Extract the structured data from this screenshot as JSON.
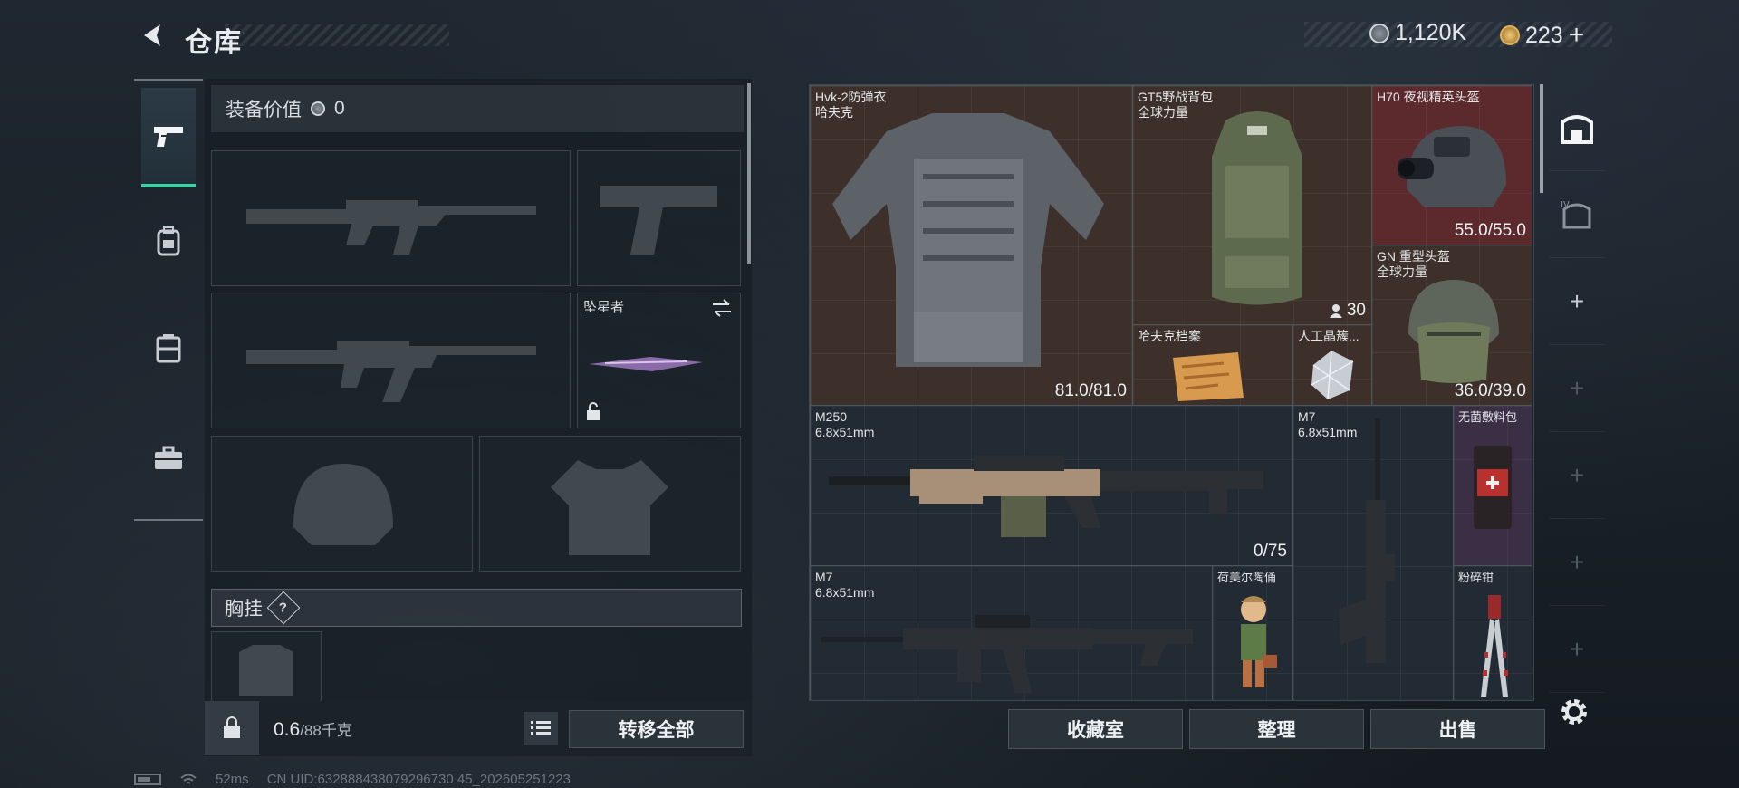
{
  "header": {
    "title": "仓库",
    "currencies": [
      {
        "icon": "silver-coin-icon",
        "value": "1,120K"
      },
      {
        "icon": "gold-coin-icon",
        "value": "223"
      }
    ],
    "add_symbol": "+"
  },
  "left_nav": {
    "tabs": [
      {
        "icon": "pistol-icon",
        "active": true
      },
      {
        "icon": "backpack-icon",
        "active": false
      },
      {
        "icon": "case-icon",
        "active": false
      },
      {
        "icon": "briefcase-icon",
        "active": false
      }
    ]
  },
  "equipment": {
    "value_label": "装备价值",
    "value": "0",
    "slots": [
      {
        "name": "primary-weapon-slot",
        "label": "",
        "empty": true
      },
      {
        "name": "pistol-slot",
        "label": "",
        "empty": true
      },
      {
        "name": "secondary-weapon-slot",
        "label": "",
        "empty": true
      },
      {
        "name": "melee-slot",
        "label": "坠星者",
        "empty": false
      },
      {
        "name": "helmet-slot",
        "label": "",
        "empty": true
      },
      {
        "name": "armor-slot",
        "label": "",
        "empty": true
      }
    ],
    "chest_rig_label": "胸挂",
    "help_symbol": "?",
    "weight_current": "0.6",
    "weight_max": "/88千克",
    "transfer_all": "转移全部"
  },
  "stash": {
    "items": [
      {
        "name": "Hvk-2防弹衣",
        "sub": "哈夫克",
        "durability": "81.0/81.0",
        "rarity": "brown"
      },
      {
        "name": "GT5野战背包",
        "sub": "全球力量",
        "count": "30",
        "rarity": "brown"
      },
      {
        "name": "H70 夜视精英头盔",
        "sub": "",
        "durability": "55.0/55.0",
        "rarity": "red"
      },
      {
        "name": "GN 重型头盔",
        "sub": "全球力量",
        "durability": "36.0/39.0",
        "rarity": "brown"
      },
      {
        "name": "哈夫克档案",
        "sub": "",
        "rarity": "brown"
      },
      {
        "name": "人工晶簇...",
        "sub": "",
        "rarity": "brown"
      },
      {
        "name": "M250",
        "sub": "6.8x51mm",
        "ammo": "0/75",
        "rarity": "dark"
      },
      {
        "name": "M7",
        "sub": "6.8x51mm",
        "rarity": "dark"
      },
      {
        "name": "无菌敷料包",
        "sub": "",
        "rarity": "purple"
      },
      {
        "name": "M7",
        "sub": "6.8x51mm",
        "rarity": "dark"
      },
      {
        "name": "荷美尔陶俑",
        "sub": "",
        "rarity": "dark"
      },
      {
        "name": "粉碎钳",
        "sub": "",
        "rarity": "dark"
      }
    ],
    "buttons": [
      "收藏室",
      "整理",
      "出售"
    ]
  },
  "right_tabs": {
    "plus_symbol": "+"
  },
  "footer": {
    "ping": "52ms",
    "uid": "CN UID:632888438079296730 45_202605251223"
  },
  "colors": {
    "accent": "#3fd0a3",
    "rarity_brown": "#3d302a",
    "rarity_red": "#5c2a2c",
    "rarity_purple": "#3a2f45"
  }
}
